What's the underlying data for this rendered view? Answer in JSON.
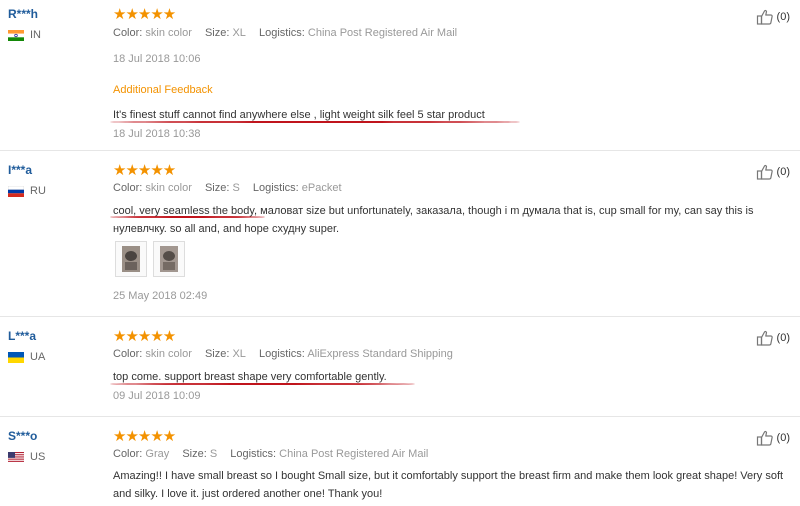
{
  "reviews": [
    {
      "user": "R***h",
      "country": "IN",
      "stars": "★★★★★",
      "color_key": "Color:",
      "color_val": "skin color",
      "size_key": "Size:",
      "size_val": "XL",
      "logistics_key": "Logistics:",
      "logistics_val": "China Post Registered Air Mail",
      "date": "18 Jul 2018 10:06",
      "additional_title": "Additional Feedback",
      "additional_text": "It's finest stuff cannot find anywhere else , light weight silk feel 5 star product",
      "additional_date": "18 Jul 2018 10:38",
      "helpful": "(0)"
    },
    {
      "user": "I***a",
      "country": "RU",
      "stars": "★★★★★",
      "color_key": "Color:",
      "color_val": "skin color",
      "size_key": "Size:",
      "size_val": "S",
      "logistics_key": "Logistics:",
      "logistics_val": "ePacket",
      "text": "cool, very seamless the body, маловат size but unfortunately, заказала, though i m думала that is, cup small for my, can say this is нулевлчку. so all and, and hope схудну super.",
      "date": "25 May 2018 02:49",
      "helpful": "(0)"
    },
    {
      "user": "L***a",
      "country": "UA",
      "stars": "★★★★★",
      "color_key": "Color:",
      "color_val": "skin color",
      "size_key": "Size:",
      "size_val": "XL",
      "logistics_key": "Logistics:",
      "logistics_val": "AliExpress Standard Shipping",
      "text": "top come. support breast shape very comfortable gently.",
      "date": "09 Jul 2018 10:09",
      "helpful": "(0)"
    },
    {
      "user": "S***o",
      "country": "US",
      "stars": "★★★★★",
      "color_key": "Color:",
      "color_val": "Gray",
      "size_key": "Size:",
      "size_val": "S",
      "logistics_key": "Logistics:",
      "logistics_val": "China Post Registered Air Mail",
      "text": "Amazing!! I have small breast so I bought Small size, but it comfortably support the breast firm and make them look great shape! Very soft and silky. I love it. just ordered another one! Thank you!",
      "helpful": "(0)"
    }
  ],
  "colors": {
    "star": "#f39200",
    "username": "#205c9b",
    "underline": "#c0141c"
  },
  "icons": {
    "helpful": "thumbs-up-icon"
  }
}
